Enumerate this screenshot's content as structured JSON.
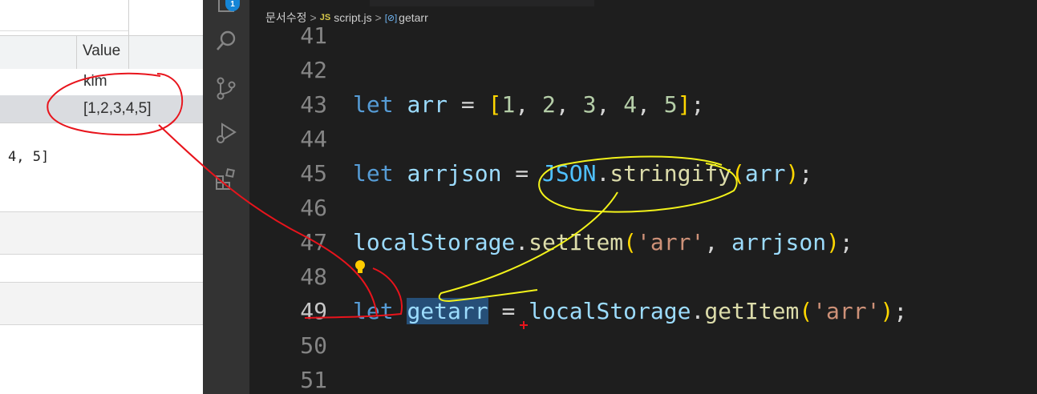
{
  "devtools": {
    "column_header": "Value",
    "rows": [
      {
        "value": "kim"
      },
      {
        "value": "[1,2,3,4,5]"
      }
    ],
    "console_output": "4, 5]"
  },
  "activity_bar": {
    "icons": [
      "explorer-icon",
      "search-icon",
      "source-control-icon",
      "run-debug-icon",
      "extensions-icon"
    ],
    "badge_count": "1"
  },
  "editor": {
    "breadcrumb": {
      "folder": "문서수정",
      "file_tag": "JS",
      "file": "script.js",
      "symbol_tag": "[⊘]",
      "symbol": "getarr"
    },
    "lines": [
      {
        "number": "41"
      },
      {
        "number": "42"
      },
      {
        "number": "43",
        "tokens": [
          [
            "kw",
            "let"
          ],
          [
            "p",
            " "
          ],
          [
            "var",
            "arr"
          ],
          [
            "p",
            " = "
          ],
          [
            "br",
            "["
          ],
          [
            "num",
            "1"
          ],
          [
            "p",
            ", "
          ],
          [
            "num",
            "2"
          ],
          [
            "p",
            ", "
          ],
          [
            "num",
            "3"
          ],
          [
            "p",
            ", "
          ],
          [
            "num",
            "4"
          ],
          [
            "p",
            ", "
          ],
          [
            "num",
            "5"
          ],
          [
            "br",
            "]"
          ],
          [
            "p",
            ";"
          ]
        ]
      },
      {
        "number": "44"
      },
      {
        "number": "45",
        "tokens": [
          [
            "kw",
            "let"
          ],
          [
            "p",
            " "
          ],
          [
            "var",
            "arrjson"
          ],
          [
            "p",
            " = "
          ],
          [
            "cls",
            "JSON"
          ],
          [
            "p",
            "."
          ],
          [
            "fn",
            "stringify"
          ],
          [
            "br",
            "("
          ],
          [
            "var",
            "arr"
          ],
          [
            "br",
            ")"
          ],
          [
            "p",
            ";"
          ]
        ]
      },
      {
        "number": "46"
      },
      {
        "number": "47",
        "tokens": [
          [
            "var",
            "localStorage"
          ],
          [
            "p",
            "."
          ],
          [
            "fn",
            "setItem"
          ],
          [
            "br",
            "("
          ],
          [
            "str",
            "'arr'"
          ],
          [
            "p",
            ", "
          ],
          [
            "var",
            "arrjson"
          ],
          [
            "br",
            ")"
          ],
          [
            "p",
            ";"
          ]
        ]
      },
      {
        "number": "48",
        "lightbulb": true
      },
      {
        "number": "49",
        "active": true,
        "tokens": [
          [
            "kw",
            "let"
          ],
          [
            "p",
            " "
          ],
          [
            "var sel",
            "getarr"
          ],
          [
            "p",
            " = "
          ],
          [
            "var",
            "localStorage"
          ],
          [
            "p",
            "."
          ],
          [
            "fn",
            "getItem"
          ],
          [
            "br",
            "("
          ],
          [
            "str",
            "'arr'"
          ],
          [
            "br",
            ")"
          ],
          [
            "p",
            ";"
          ]
        ]
      },
      {
        "number": "50"
      },
      {
        "number": "51"
      }
    ]
  },
  "colors": {
    "editor_bg": "#1e1e1e",
    "activity_bar_bg": "#333333",
    "keyword": "#569cd6",
    "variable": "#9cdcfe",
    "function": "#dcdcaa",
    "string": "#ce9178",
    "number": "#b5cea8",
    "bracket": "#ffd700",
    "annotation_red": "#e8141c",
    "annotation_yellow": "#f2f21a"
  }
}
